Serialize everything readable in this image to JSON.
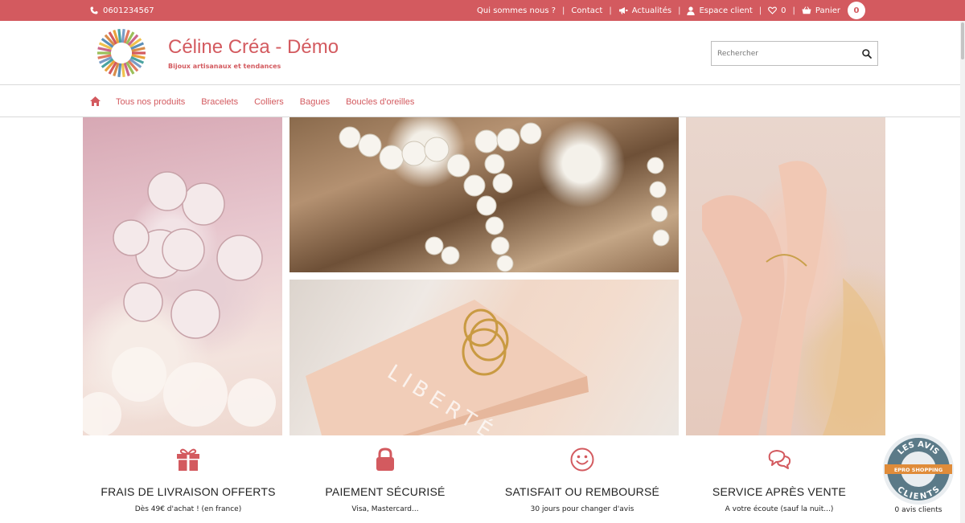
{
  "topbar": {
    "phone": "0601234567",
    "links": {
      "about": "Qui sommes nous ?",
      "contact": "Contact",
      "news": "Actualités",
      "account": "Espace client",
      "wishlist_count": "0",
      "cart": "Panier",
      "cart_count": "0"
    },
    "separator": "|"
  },
  "header": {
    "title": "Céline Créa - Démo",
    "subtitle": "Bijoux artisanaux et tendances",
    "search_placeholder": "Rechercher"
  },
  "nav": {
    "items": [
      "Tous nos produits",
      "Bracelets",
      "Colliers",
      "Bagues",
      "Boucles d'oreilles"
    ]
  },
  "colors": {
    "accent": "#d35a5f",
    "text": "#222222",
    "border": "#d9d9d9"
  },
  "photos": {
    "bottom_text": "LIBERTÉ"
  },
  "features": [
    {
      "icon": "gift-icon",
      "title": "FRAIS DE LIVRAISON OFFERTS",
      "subtitle": "Dès 49€ d'achat ! (en france)"
    },
    {
      "icon": "lock-icon",
      "title": "PAIEMENT SÉCURISÉ",
      "subtitle": "Visa, Mastercard..."
    },
    {
      "icon": "smile-icon",
      "title": "SATISFAIT OU REMBOURSÉ",
      "subtitle": "30 jours pour changer d'avis"
    },
    {
      "icon": "chat-icon",
      "title": "SERVICE APRÈS VENTE",
      "subtitle": "A votre écoute (sauf la nuit...)"
    }
  ],
  "reviews": {
    "badge_top": "LES AVIS",
    "badge_band": "EPRO SHOPPING",
    "badge_bottom": "CLIENTS",
    "count_label": "0 avis clients"
  }
}
